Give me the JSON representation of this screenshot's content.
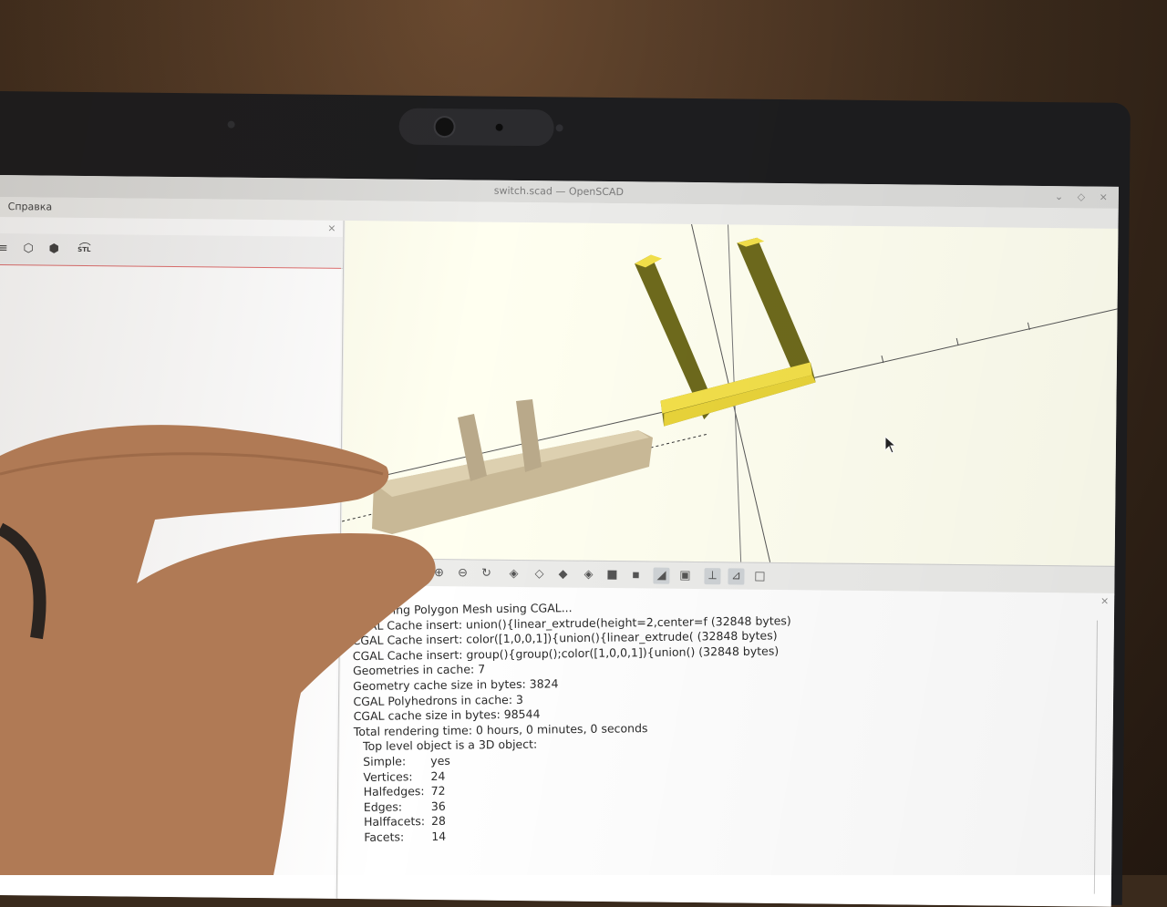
{
  "window": {
    "title": "switch.scad — OpenSCAD",
    "controls": [
      "⌄",
      "◇",
      "×"
    ]
  },
  "menu": {
    "items": [
      "Справка"
    ]
  },
  "editor": {
    "close": "×",
    "toolbar_stl_label": "STL"
  },
  "console": {
    "close": "×",
    "lines": [
      "Rendering Polygon Mesh using CGAL...",
      "CGAL Cache insert: union(){linear_extrude(height=2,center=f (32848 bytes)",
      "CGAL Cache insert: color([1,0,0,1]){union(){linear_extrude( (32848 bytes)",
      "CGAL Cache insert: group(){group();color([1,0,0,1]){union() (32848 bytes)",
      "Geometries in cache: 7",
      "Geometry cache size in bytes: 3824",
      "CGAL Polyhedrons in cache: 3",
      "CGAL cache size in bytes: 98544",
      "Total rendering time: 0 hours, 0 minutes, 0 seconds"
    ],
    "top_level": "Top level object is a 3D object:",
    "stats": [
      {
        "key": "Simple:",
        "value": "yes"
      },
      {
        "key": "Vertices:",
        "value": "24"
      },
      {
        "key": "Halfedges:",
        "value": "72"
      },
      {
        "key": "Edges:",
        "value": "36"
      },
      {
        "key": "Halffacets:",
        "value": "28"
      },
      {
        "key": "Facets:",
        "value": "14"
      }
    ]
  },
  "colors": {
    "model_side": "#6e6a1c",
    "model_top": "#f3e04a",
    "viewport_bg": "#fffff0",
    "printed_part": "#c8b896"
  }
}
